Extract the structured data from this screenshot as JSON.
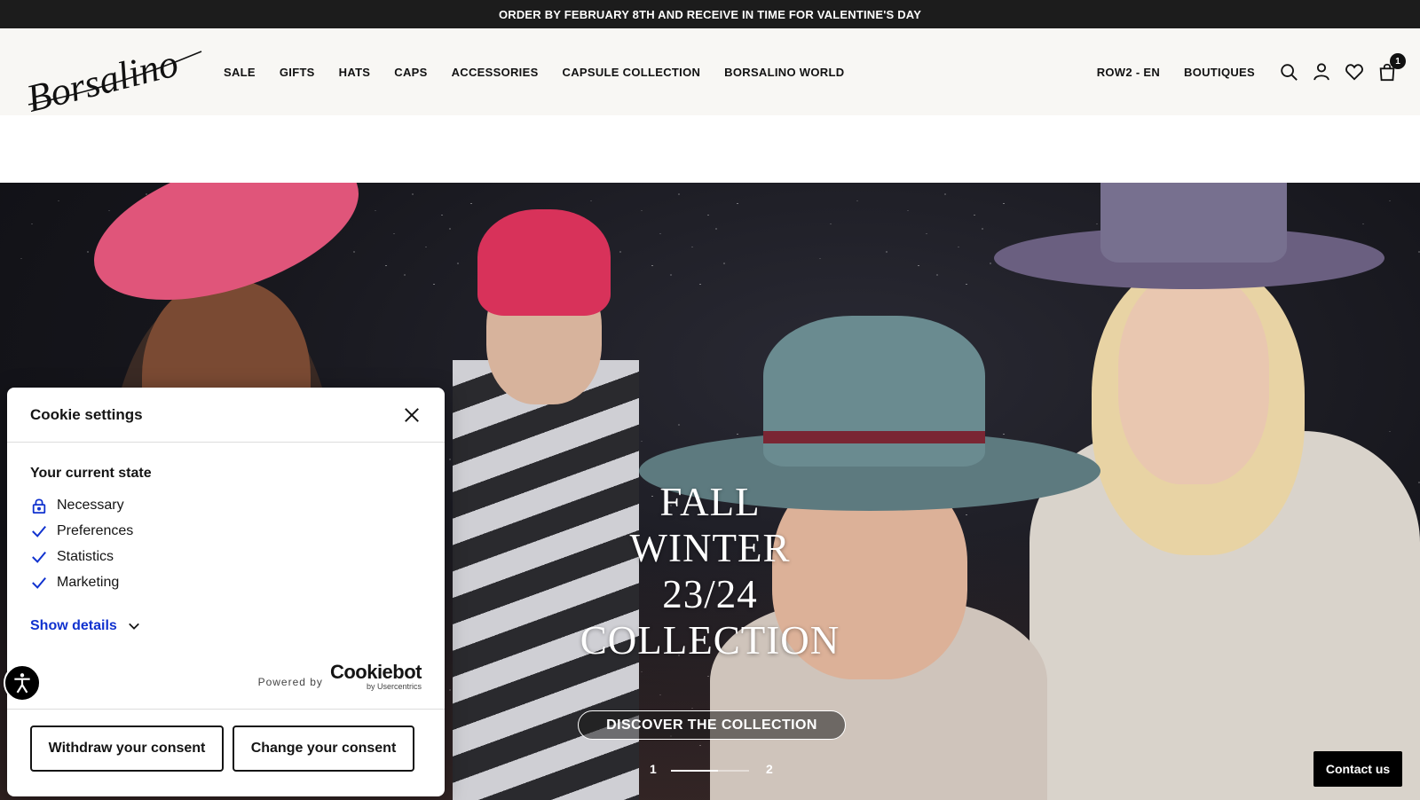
{
  "announcement": "ORDER BY FEBRUARY 8TH AND RECEIVE IN TIME FOR VALENTINE'S DAY",
  "logo": "Borsalino",
  "nav": {
    "items": [
      "SALE",
      "GIFTS",
      "HATS",
      "CAPS",
      "ACCESSORIES",
      "CAPSULE COLLECTION",
      "BORSALINO WORLD"
    ],
    "region": "ROW2 - EN",
    "boutiques": "BOUTIQUES",
    "icons": [
      "search-icon",
      "account-icon",
      "wishlist-icon",
      "cart-icon"
    ],
    "cart_count": "1"
  },
  "hero": {
    "title_lines": [
      "FALL",
      "WINTER",
      "23/24",
      "COLLECTION"
    ],
    "cta": "DISCOVER THE COLLECTION",
    "slides": [
      "1",
      "2"
    ],
    "slide_progress": 0.6
  },
  "cookie": {
    "title": "Cookie settings",
    "state_heading": "Your current state",
    "categories": [
      {
        "label": "Necessary",
        "icon": "lock-icon"
      },
      {
        "label": "Preferences",
        "icon": "check-icon"
      },
      {
        "label": "Statistics",
        "icon": "check-icon"
      },
      {
        "label": "Marketing",
        "icon": "check-icon"
      }
    ],
    "show_details": "Show details",
    "powered_by": "Powered by",
    "brand": "Cookiebot",
    "brand_sub": "by Usercentrics",
    "withdraw": "Withdraw your consent",
    "change": "Change your consent"
  },
  "contact": "Contact us",
  "colors": {
    "link_blue": "#1032cf",
    "dark": "#141414",
    "header_bg": "#f8f7f4"
  }
}
